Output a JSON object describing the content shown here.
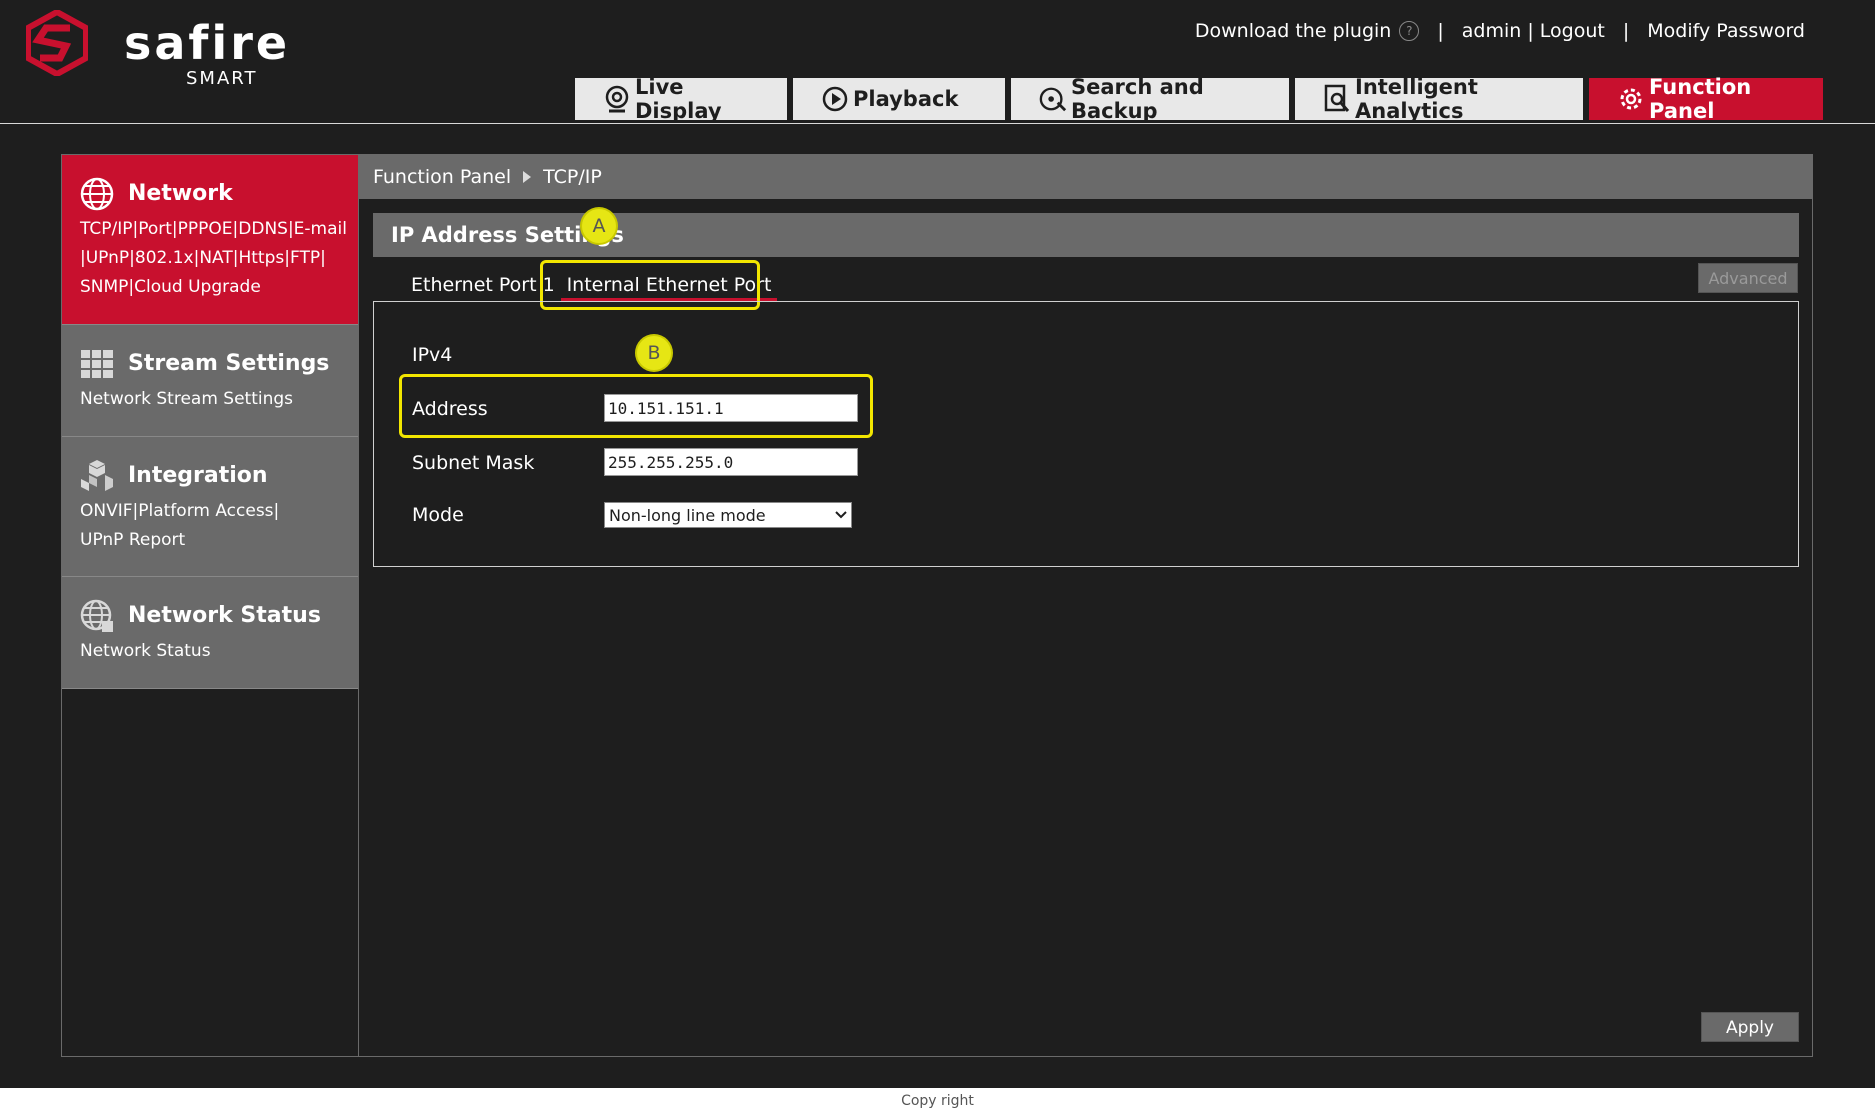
{
  "brand": {
    "name": "safire",
    "sub": "SMART",
    "color": "#c8102e"
  },
  "toplinks": {
    "download": "Download the plugin",
    "help_icon": "?",
    "sep": "|",
    "user": "admin",
    "user_sep": " | ",
    "logout": "Logout",
    "modify_password": "Modify Password"
  },
  "navtabs": [
    {
      "label": "Live Display",
      "icon": "webcam-icon"
    },
    {
      "label": "Playback",
      "icon": "play-circle-icon"
    },
    {
      "label": "Search and Backup",
      "icon": "disc-search-icon"
    },
    {
      "label": "Intelligent Analytics",
      "icon": "analytics-icon"
    },
    {
      "label": "Function Panel",
      "icon": "gear-icon"
    }
  ],
  "sidebar": {
    "items": [
      {
        "title": "Network",
        "lines": [
          "TCP/IP|Port|PPPOE|DDNS|E-mail",
          "|UPnP|802.1x|NAT|Https|FTP|",
          "SNMP|Cloud Upgrade"
        ],
        "icon": "globe-icon"
      },
      {
        "title": "Stream Settings",
        "lines": [
          "Network Stream Settings"
        ],
        "icon": "grid-icon"
      },
      {
        "title": "Integration",
        "lines": [
          "ONVIF|Platform Access|",
          "UPnP Report"
        ],
        "icon": "cubes-icon"
      },
      {
        "title": "Network Status",
        "lines": [
          "Network Status"
        ],
        "icon": "globe-status-icon"
      }
    ]
  },
  "breadcrumb": {
    "root": "Function Panel",
    "current": "TCP/IP"
  },
  "section": {
    "title": "IP Address Settings"
  },
  "markers": {
    "a": "A",
    "b": "B",
    "color": "#e6e614"
  },
  "tabs": {
    "port1": "Ethernet Port 1",
    "internal": "Internal Ethernet Port"
  },
  "advanced": "Advanced",
  "form": {
    "ipv4": "IPv4",
    "address_label": "Address",
    "address_value": "10.151.151.1",
    "subnet_label": "Subnet Mask",
    "subnet_value": "255.255.255.0",
    "mode_label": "Mode",
    "mode_value": "Non-long line mode"
  },
  "apply": "Apply",
  "footer": "Copy right"
}
